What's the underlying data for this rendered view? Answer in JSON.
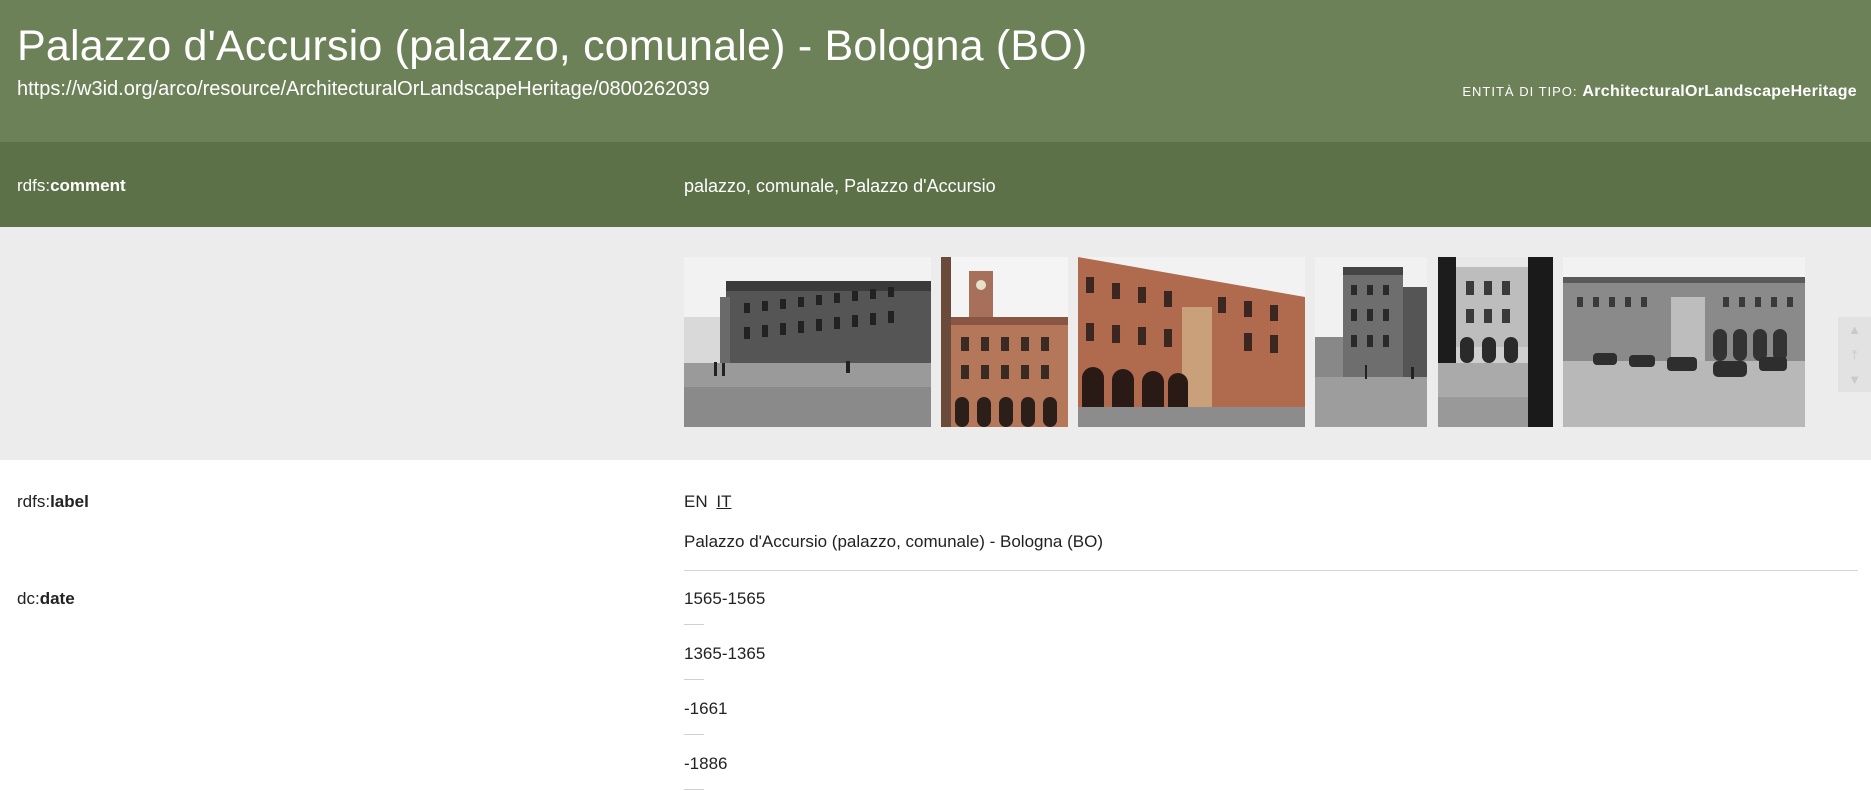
{
  "header": {
    "title": "Palazzo d'Accursio (palazzo, comunale) - Bologna (BO)",
    "uri": "https://w3id.org/arco/resource/ArchitecturalOrLandscapeHeritage/0800262039",
    "entity_type_label": "ENTITÀ DI TIPO:",
    "entity_type_value": "ArchitecturalOrLandscapeHeritage"
  },
  "comment": {
    "prefix": "rdfs:",
    "local": "comment",
    "value": "palazzo, comunale, Palazzo d'Accursio"
  },
  "gallery": {
    "images": [
      {
        "name": "photo-palazzo-piazza-grayscale",
        "tone": "grayscale"
      },
      {
        "name": "photo-palazzo-clock-tower",
        "tone": "color"
      },
      {
        "name": "photo-palazzo-facade-color",
        "tone": "color"
      },
      {
        "name": "photo-palazzo-side-street",
        "tone": "grayscale"
      },
      {
        "name": "photo-palazzo-courtyard",
        "tone": "grayscale"
      },
      {
        "name": "photo-palazzo-courtyard-cars",
        "tone": "grayscale"
      }
    ],
    "controls": [
      "chevron-up-icon",
      "skip-to-top-icon",
      "chevron-down-icon"
    ]
  },
  "label_row": {
    "prefix": "rdfs:",
    "local": "label",
    "languages": [
      "EN",
      "IT"
    ],
    "active_language": "EN",
    "value": "Palazzo d'Accursio (palazzo, comunale) - Bologna (BO)"
  },
  "date_row": {
    "prefix": "dc:",
    "local": "date",
    "values": [
      "1565-1565",
      "1365-1365",
      "-1661",
      "-1886"
    ]
  },
  "colors": {
    "header_bg": "#6c8158",
    "comment_bg": "#5c7148",
    "gallery_bg": "#ececec"
  }
}
